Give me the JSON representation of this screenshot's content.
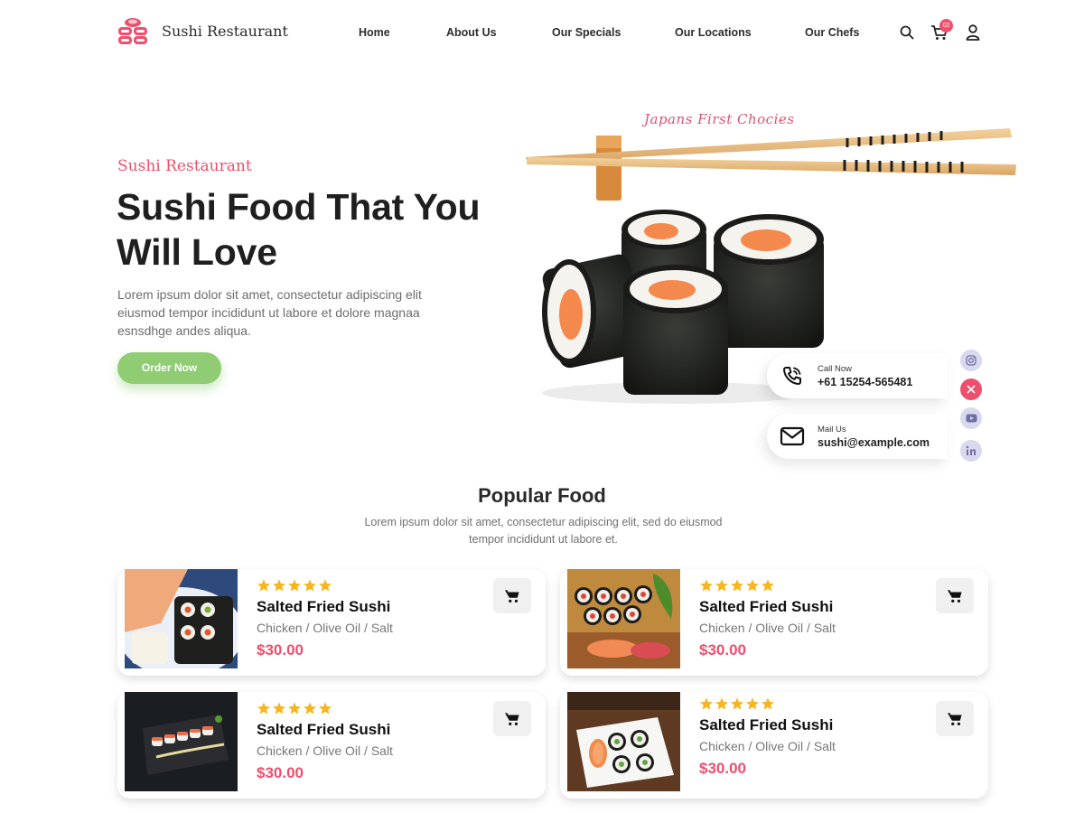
{
  "brand": {
    "name": "Sushi Restaurant"
  },
  "nav": {
    "items": [
      {
        "label": "Home"
      },
      {
        "label": "About Us"
      },
      {
        "label": "Our Specials"
      },
      {
        "label": "Our Locations"
      },
      {
        "label": "Our Chefs"
      }
    ],
    "cart_count": "02"
  },
  "hero": {
    "eyebrow": "Sushi Restaurant",
    "title": "Sushi Food That You Will Love",
    "description": "Lorem ipsum dolor sit amet, consectetur adipiscing elit eiusmod tempor incididunt ut labore et dolore magnaa esnsdhge andes aliqua.",
    "cta": "Order Now",
    "image_caption": "Japans First Chocies"
  },
  "contact": {
    "call_label": "Call Now",
    "call_value": "+61 15254-565481",
    "mail_label": "Mail Us",
    "mail_value": "sushi@example.com"
  },
  "social": [
    "instagram-icon",
    "x-icon",
    "youtube-icon",
    "linkedin-icon"
  ],
  "popular": {
    "title": "Popular Food",
    "description": "Lorem ipsum dolor sit amet, consectetur adipiscing elit, sed do eiusmod tempor incididunt ut labore et.",
    "items": [
      {
        "name": "Salted Fried Sushi",
        "ingredients": "Chicken / Olive Oil / Salt",
        "price": "$30.00",
        "rating": 5
      },
      {
        "name": "Salted Fried Sushi",
        "ingredients": "Chicken / Olive Oil / Salt",
        "price": "$30.00",
        "rating": 5
      },
      {
        "name": "Salted Fried Sushi",
        "ingredients": "Chicken / Olive Oil / Salt",
        "price": "$30.00",
        "rating": 5
      },
      {
        "name": "Salted Fried Sushi",
        "ingredients": "Chicken / Olive Oil / Salt",
        "price": "$30.00",
        "rating": 5
      }
    ]
  },
  "colors": {
    "accent": "#ef4f6c",
    "cta_green": "#8fcc74",
    "star": "#f7b51e",
    "social_bg": "#d8d8ef"
  }
}
